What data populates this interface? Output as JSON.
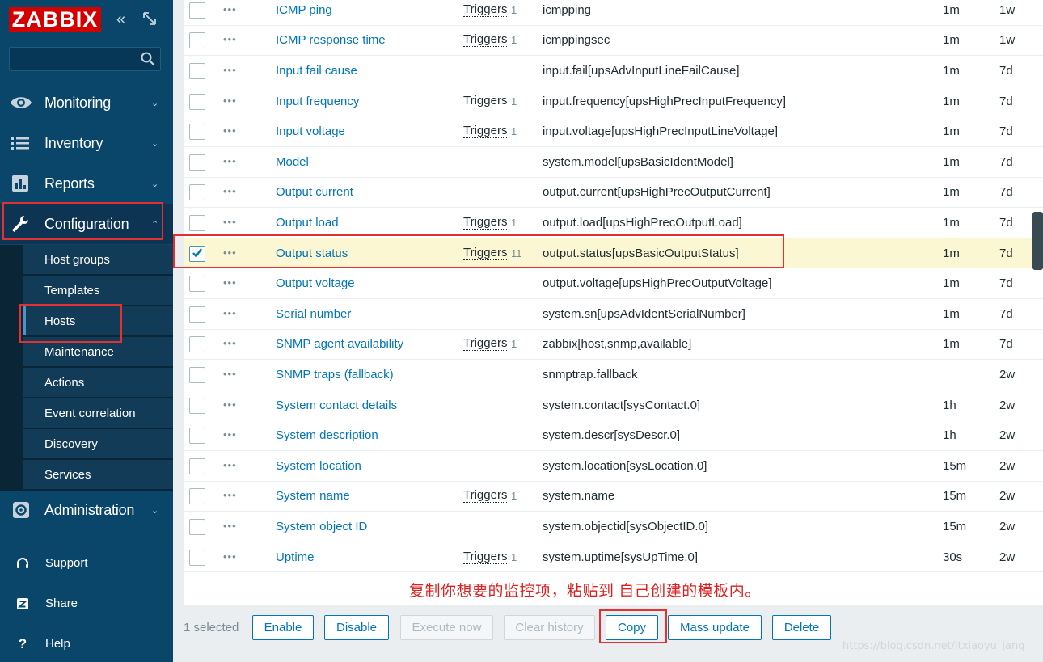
{
  "sidebar": {
    "logo": "ZABBIX",
    "search": {
      "value": "",
      "placeholder": ""
    },
    "menu": [
      {
        "label": "Monitoring",
        "icon": "eye-icon"
      },
      {
        "label": "Inventory",
        "icon": "list-icon"
      },
      {
        "label": "Reports",
        "icon": "bar-chart-icon"
      },
      {
        "label": "Configuration",
        "icon": "wrench-icon"
      },
      {
        "label": "Administration",
        "icon": "gear-icon"
      }
    ],
    "config_submenu": [
      "Host groups",
      "Templates",
      "Hosts",
      "Maintenance",
      "Actions",
      "Event correlation",
      "Discovery",
      "Services"
    ],
    "bottom": [
      {
        "label": "Support",
        "icon": "headset-icon"
      },
      {
        "label": "Share",
        "icon": "share-icon"
      },
      {
        "label": "Help",
        "icon": "help-icon"
      }
    ]
  },
  "items": [
    {
      "name": "ICMP ping",
      "triggers": "Triggers",
      "trigger_count": "1",
      "key": "icmpping",
      "interval": "1m",
      "history": "1w",
      "checked": false
    },
    {
      "name": "ICMP response time",
      "triggers": "Triggers",
      "trigger_count": "1",
      "key": "icmppingsec",
      "interval": "1m",
      "history": "1w",
      "checked": false
    },
    {
      "name": "Input fail cause",
      "triggers": "",
      "trigger_count": "",
      "key": "input.fail[upsAdvInputLineFailCause]",
      "interval": "1m",
      "history": "7d",
      "checked": false
    },
    {
      "name": "Input frequency",
      "triggers": "Triggers",
      "trigger_count": "1",
      "key": "input.frequency[upsHighPrecInputFrequency]",
      "interval": "1m",
      "history": "7d",
      "checked": false
    },
    {
      "name": "Input voltage",
      "triggers": "Triggers",
      "trigger_count": "1",
      "key": "input.voltage[upsHighPrecInputLineVoltage]",
      "interval": "1m",
      "history": "7d",
      "checked": false
    },
    {
      "name": "Model",
      "triggers": "",
      "trigger_count": "",
      "key": "system.model[upsBasicIdentModel]",
      "interval": "1m",
      "history": "7d",
      "checked": false
    },
    {
      "name": "Output current",
      "triggers": "",
      "trigger_count": "",
      "key": "output.current[upsHighPrecOutputCurrent]",
      "interval": "1m",
      "history": "7d",
      "checked": false
    },
    {
      "name": "Output load",
      "triggers": "Triggers",
      "trigger_count": "1",
      "key": "output.load[upsHighPrecOutputLoad]",
      "interval": "1m",
      "history": "7d",
      "checked": false
    },
    {
      "name": "Output status",
      "triggers": "Triggers",
      "trigger_count": "11",
      "key": "output.status[upsBasicOutputStatus]",
      "interval": "1m",
      "history": "7d",
      "checked": true
    },
    {
      "name": "Output voltage",
      "triggers": "",
      "trigger_count": "",
      "key": "output.voltage[upsHighPrecOutputVoltage]",
      "interval": "1m",
      "history": "7d",
      "checked": false
    },
    {
      "name": "Serial number",
      "triggers": "",
      "trigger_count": "",
      "key": "system.sn[upsAdvIdentSerialNumber]",
      "interval": "1m",
      "history": "7d",
      "checked": false
    },
    {
      "name": "SNMP agent availability",
      "triggers": "Triggers",
      "trigger_count": "1",
      "key": "zabbix[host,snmp,available]",
      "interval": "1m",
      "history": "7d",
      "checked": false
    },
    {
      "name": "SNMP traps (fallback)",
      "triggers": "",
      "trigger_count": "",
      "key": "snmptrap.fallback",
      "interval": "",
      "history": "2w",
      "checked": false
    },
    {
      "name": "System contact details",
      "triggers": "",
      "trigger_count": "",
      "key": "system.contact[sysContact.0]",
      "interval": "1h",
      "history": "2w",
      "checked": false
    },
    {
      "name": "System description",
      "triggers": "",
      "trigger_count": "",
      "key": "system.descr[sysDescr.0]",
      "interval": "1h",
      "history": "2w",
      "checked": false
    },
    {
      "name": "System location",
      "triggers": "",
      "trigger_count": "",
      "key": "system.location[sysLocation.0]",
      "interval": "15m",
      "history": "2w",
      "checked": false
    },
    {
      "name": "System name",
      "triggers": "Triggers",
      "trigger_count": "1",
      "key": "system.name",
      "interval": "15m",
      "history": "2w",
      "checked": false
    },
    {
      "name": "System object ID",
      "triggers": "",
      "trigger_count": "",
      "key": "system.objectid[sysObjectID.0]",
      "interval": "15m",
      "history": "2w",
      "checked": false
    },
    {
      "name": "Uptime",
      "triggers": "Triggers",
      "trigger_count": "1",
      "key": "system.uptime[sysUpTime.0]",
      "interval": "30s",
      "history": "2w",
      "checked": false
    }
  ],
  "annotation": "复制你想要的监控项，粘贴到 自己创建的模板内。",
  "actions": {
    "selected": "1 selected",
    "enable": "Enable",
    "disable": "Disable",
    "execute_now": "Execute now",
    "clear_history": "Clear history",
    "copy": "Copy",
    "mass_update": "Mass update",
    "delete": "Delete"
  },
  "watermark": "https://blog.csdn.net/itxiaoyu_jang",
  "colors": {
    "sidebar": "#0a466a",
    "link": "#0275b8",
    "highlight_row": "#fbf7d2",
    "annotation": "#e33131"
  }
}
